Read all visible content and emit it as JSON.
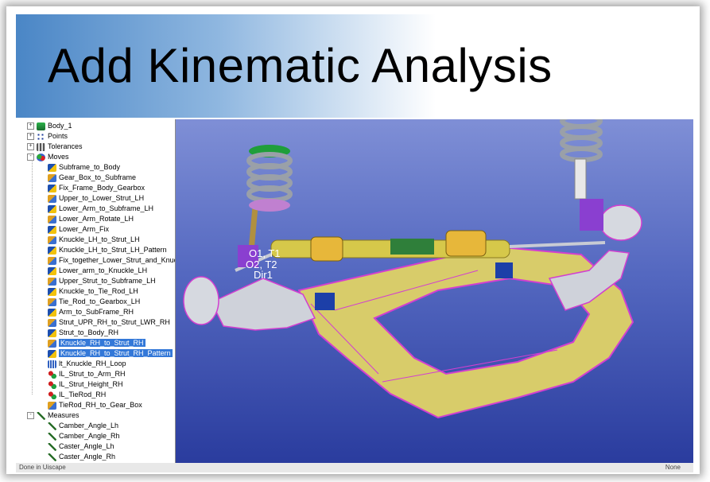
{
  "slide": {
    "title": "Add Kinematic Analysis"
  },
  "tree": {
    "top_level": [
      {
        "label": "Body_1",
        "icon": "body-icon",
        "expander": "+"
      },
      {
        "label": "Points",
        "icon": "points-icon",
        "expander": "+"
      },
      {
        "label": "Tolerances",
        "icon": "tolerances-icon",
        "expander": "+"
      },
      {
        "label": "Moves",
        "icon": "moves-icon",
        "expander": "-"
      }
    ],
    "moves": [
      {
        "label": "Subframe_to_Body",
        "selected": false
      },
      {
        "label": "Gear_Box_to_Subframe",
        "selected": false
      },
      {
        "label": "Fix_Frame_Body_Gearbox",
        "selected": false
      },
      {
        "label": "Upper_to_Lower_Strut_LH",
        "selected": false
      },
      {
        "label": "Lower_Arm_to_Subframe_LH",
        "selected": false
      },
      {
        "label": "Lower_Arm_Rotate_LH",
        "selected": false
      },
      {
        "label": "Lower_Arm_Fix",
        "selected": false
      },
      {
        "label": "Knuckle_LH_to_Strut_LH",
        "selected": false
      },
      {
        "label": "Knuckle_LH_to_Strut_LH_Pattern",
        "selected": false
      },
      {
        "label": "Fix_together_Lower_Strut_and_Knuckle_LH",
        "selected": false
      },
      {
        "label": "Lower_arm_to_Knuckle_LH",
        "selected": false
      },
      {
        "label": "Upper_Strut_to_Subframe_LH",
        "selected": false
      },
      {
        "label": "Knuckle_to_Tie_Rod_LH",
        "selected": false
      },
      {
        "label": "Tie_Rod_to_Gearbox_LH",
        "selected": false
      },
      {
        "label": "Arm_to_SubFrame_RH",
        "selected": false
      },
      {
        "label": "Strut_UPR_RH_to_Strut_LWR_RH",
        "selected": false
      },
      {
        "label": "Strut_to_Body_RH",
        "selected": false
      },
      {
        "label": "Knuckle_RH_to_Strut_RH",
        "selected": true
      },
      {
        "label": "Knuckle_RH_to_Strut_RH_Pattern",
        "selected": true
      },
      {
        "label": "lt_Knuckle_RH_Loop",
        "selected": false
      },
      {
        "label": "IL_Strut_to_Arm_RH",
        "selected": false
      },
      {
        "label": "IL_Strut_Height_RH",
        "selected": false
      },
      {
        "label": "IL_TieRod_RH",
        "selected": false
      },
      {
        "label": "TieRod_RH_to_Gear_Box",
        "selected": false
      }
    ],
    "measures_label": "Measures",
    "measures": [
      {
        "label": "Camber_Angle_Lh"
      },
      {
        "label": "Camber_Angle_Rh"
      },
      {
        "label": "Caster_Angle_Lh"
      },
      {
        "label": "Caster_Angle_Rh"
      }
    ]
  },
  "viewport": {
    "labels": [
      "O1, T1",
      "O2, T2",
      "Dir1"
    ]
  },
  "status": {
    "left": "Done in Uiscape",
    "right": "None"
  },
  "colors": {
    "title_gradient_start": "#4a86c6",
    "viewport_top": "#7f8fd6",
    "viewport_bottom": "#2a3c9e",
    "selection": "#3378d8",
    "subframe": "#d8cc6a",
    "edges": "#d23fd0",
    "spring": "#9aa0a8",
    "strut_top": "#1f9e3a"
  }
}
